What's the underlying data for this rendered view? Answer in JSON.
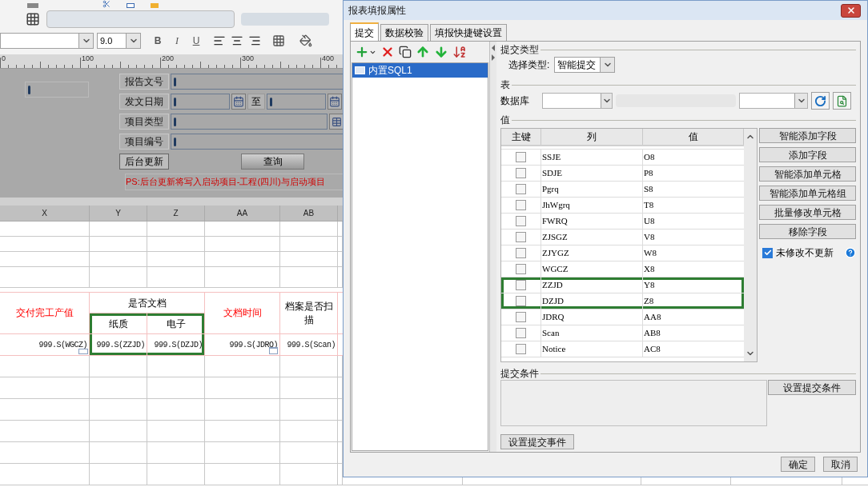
{
  "app": {
    "font_size": "9.0",
    "format_buttons": [
      {
        "label": "B",
        "kind": "bold"
      },
      {
        "label": "I",
        "kind": "italic"
      },
      {
        "label": "U",
        "kind": "underline"
      }
    ],
    "ruler": [
      "0",
      "100",
      "200",
      "300",
      "400"
    ],
    "form": {
      "fields": [
        {
          "label": "报告文号",
          "kind": "text"
        },
        {
          "label": "发文日期",
          "kind": "daterange",
          "separator": "至"
        },
        {
          "label": "项目类型",
          "kind": "combo"
        },
        {
          "label": "项目编号",
          "kind": "text"
        }
      ],
      "buttons": [
        "后台更新",
        "查询"
      ],
      "note": "PS:后台更新将写入启动项目-工程(四川)与启动项目"
    },
    "sheet": {
      "columns": [
        {
          "label": "X"
        },
        {
          "label": "Y"
        },
        {
          "label": "Z"
        },
        {
          "label": "AA"
        },
        {
          "label": "AB"
        }
      ],
      "headers": [
        {
          "text": "交付完工产值",
          "emphasis": true
        },
        {
          "text": "是否文档",
          "emphasis": false,
          "children": [
            {
              "text": "纸质",
              "highlighted": true
            },
            {
              "text": "电子",
              "highlighted": true
            }
          ]
        },
        {
          "text": "文档时间",
          "emphasis": true
        },
        {
          "text": "档案是否扫描",
          "emphasis": false
        }
      ],
      "cells": [
        {
          "text": "999.S(WGCZ)",
          "kind": "number",
          "highlighted": false
        },
        {
          "text": "999.S(ZZJD)",
          "kind": "text",
          "highlighted": true
        },
        {
          "text": "999.S(DZJD)",
          "kind": "text",
          "highlighted": true
        },
        {
          "text": "999.S(JDRQ)",
          "kind": "date",
          "highlighted": false
        },
        {
          "text": "999.S(Scan)",
          "kind": "text",
          "highlighted": false
        }
      ]
    }
  },
  "dialog": {
    "title": "报表填报属性",
    "tabs": [
      {
        "label": "提交",
        "selected": true
      },
      {
        "label": "数据校验",
        "selected": false
      },
      {
        "label": "填报快捷键设置",
        "selected": false
      }
    ],
    "submissions": [
      {
        "label": "内置SQL1",
        "selected": true
      }
    ],
    "submit_type": {
      "heading": "提交类型",
      "label": "选择类型:",
      "value": "智能提交"
    },
    "table_group": {
      "heading": "表",
      "database_label": "数据库"
    },
    "values": {
      "heading": "值",
      "columns": [
        "主键",
        "列",
        "值"
      ],
      "rows": [
        {
          "column": "SSJE",
          "value": "O8",
          "primary_key": false,
          "highlighted": false
        },
        {
          "column": "SDJE",
          "value": "P8",
          "primary_key": false,
          "highlighted": false
        },
        {
          "column": "Pgrq",
          "value": "S8",
          "primary_key": false,
          "highlighted": false
        },
        {
          "column": "JhWgrq",
          "value": "T8",
          "primary_key": false,
          "highlighted": false
        },
        {
          "column": "FWRQ",
          "value": "U8",
          "primary_key": false,
          "highlighted": false
        },
        {
          "column": "ZJSGZ",
          "value": "V8",
          "primary_key": false,
          "highlighted": false
        },
        {
          "column": "ZJYGZ",
          "value": "W8",
          "primary_key": false,
          "highlighted": false
        },
        {
          "column": "WGCZ",
          "value": "X8",
          "primary_key": false,
          "highlighted": false
        },
        {
          "column": "ZZJD",
          "value": "Y8",
          "primary_key": false,
          "highlighted": true
        },
        {
          "column": "DZJD",
          "value": "Z8",
          "primary_key": false,
          "highlighted": true
        },
        {
          "column": "JDRQ",
          "value": "AA8",
          "primary_key": false,
          "highlighted": false
        },
        {
          "column": "Scan",
          "value": "AB8",
          "primary_key": false,
          "highlighted": false
        },
        {
          "column": "Notice",
          "value": "AC8",
          "primary_key": false,
          "highlighted": false
        }
      ],
      "buttons": [
        "智能添加字段",
        "添加字段",
        "智能添加单元格",
        "智能添加单元格组",
        "批量修改单元格",
        "移除字段"
      ],
      "option": {
        "label": "未修改不更新",
        "checked": true
      }
    },
    "condition": {
      "heading": "提交条件",
      "button": "设置提交条件"
    },
    "event_button": "设置提交事件",
    "footer_buttons": [
      "确定",
      "取消"
    ]
  }
}
